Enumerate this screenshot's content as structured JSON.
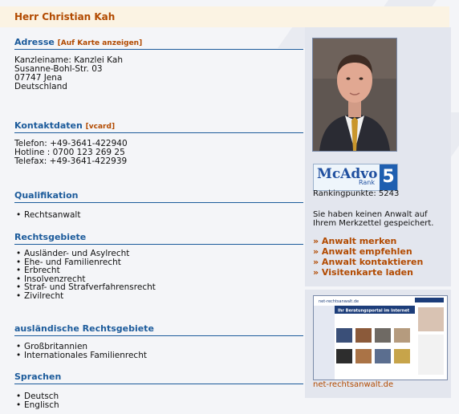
{
  "header": {
    "name": "Herr Christian Kah"
  },
  "adresse": {
    "title": "Adresse",
    "map_link": "[Auf Karte anzeigen]",
    "lines": [
      "Kanzleiname: Kanzlei Kah",
      "Susanne-Bohl-Str. 03",
      "07747 Jena",
      "Deutschland"
    ]
  },
  "kontakt": {
    "title": "Kontaktdaten",
    "vcard_link": "[vcard]",
    "lines": [
      "Telefon: +49-3641-422940",
      "Hotline : 0700 123 269 25",
      "Telefax: +49-3641-422939"
    ]
  },
  "qualifikation": {
    "title": "Qualifikation",
    "items": [
      "Rechtsanwalt"
    ]
  },
  "rechtsgebiete": {
    "title": "Rechtsgebiete",
    "items": [
      "Ausländer- und Asylrecht",
      "Ehe- und Familienrecht",
      "Erbrecht",
      "Insolvenzrecht",
      "Straf- und Strafverfahrensrecht",
      "Zivilrecht"
    ]
  },
  "auslaendisch": {
    "title": "ausländische Rechtsgebiete",
    "items": [
      "Großbritannien",
      "Internationales Familienrecht"
    ]
  },
  "sprachen": {
    "title": "Sprachen",
    "items": [
      "Deutsch",
      "Englisch"
    ]
  },
  "sidebar": {
    "logo_text": "McAdvo",
    "logo_rank": "Rank",
    "logo_number": "5",
    "ranking_points": "Rankingpunkte: 5243",
    "merkzettel_text": "Sie haben keinen Anwalt auf Ihrem Merkzettel gespeichert.",
    "actions": [
      "» Anwalt merken",
      "» Anwalt empfehlen",
      "» Anwalt kontaktieren",
      "» Visitenkarte laden"
    ],
    "site_thumb_title": "Ihr Beratungsportal im Internet",
    "site_thumb_brand": "net-rechtsanwalt.de",
    "site_link": "net-rechtsanwalt.de"
  }
}
